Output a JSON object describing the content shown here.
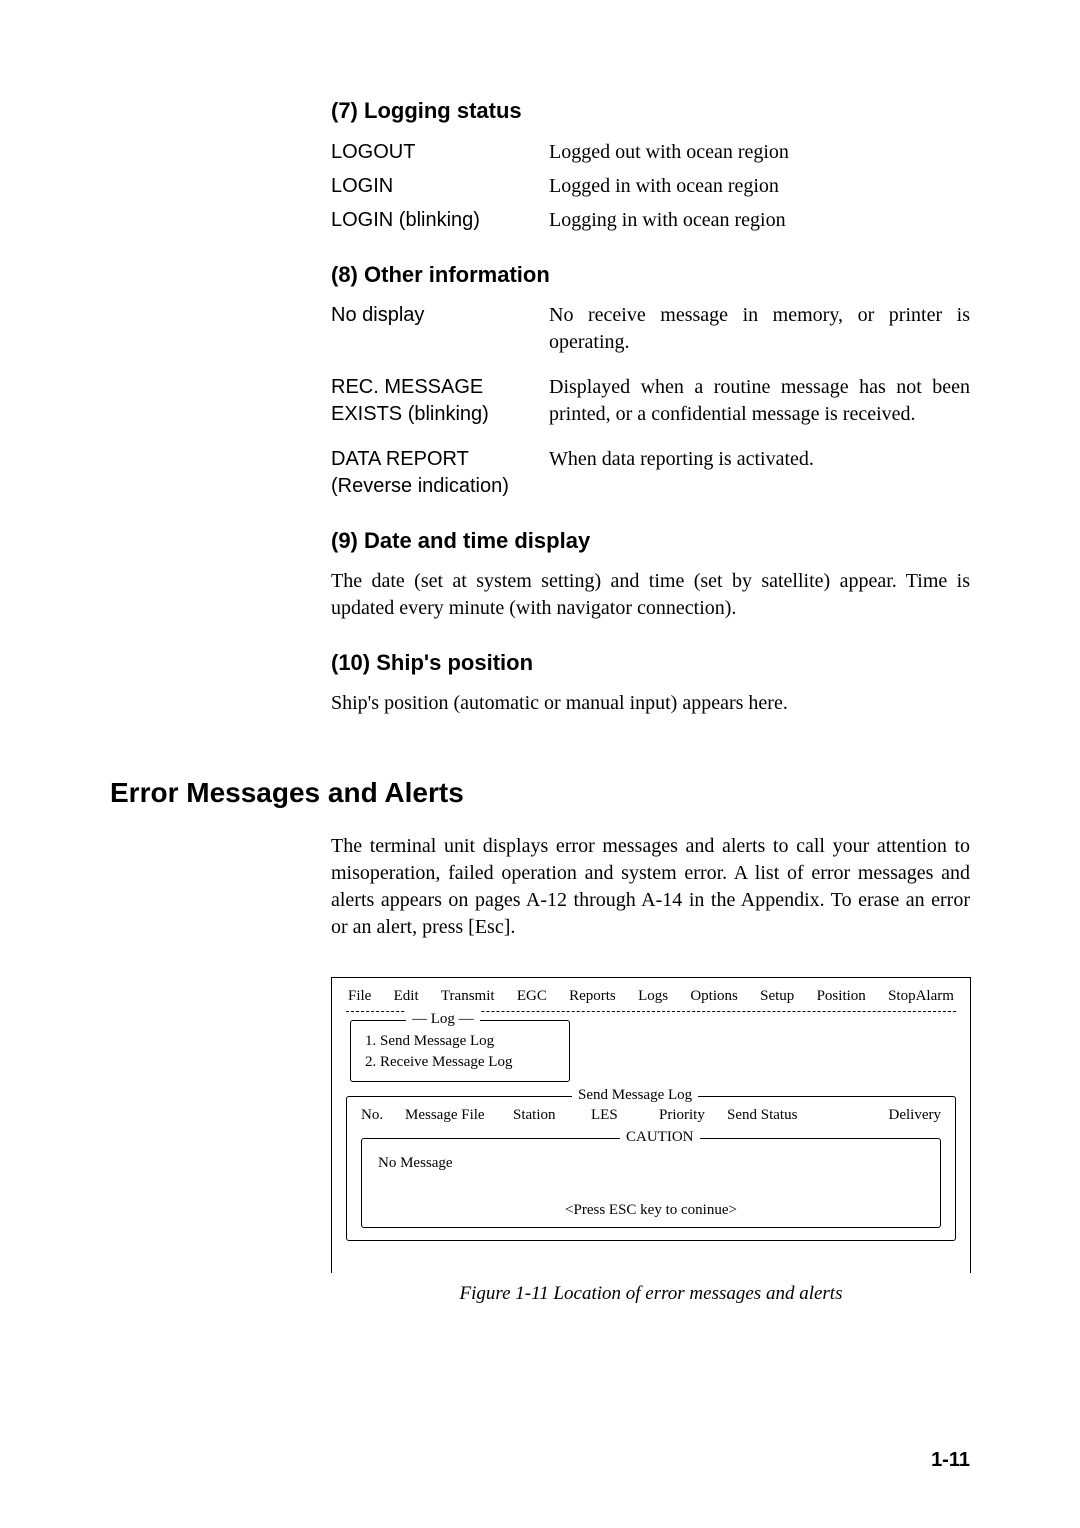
{
  "section7": {
    "heading": "(7) Logging status",
    "rows": [
      {
        "term": "LOGOUT",
        "desc": "Logged out with ocean region"
      },
      {
        "term": "LOGIN",
        "desc": "Logged in with ocean region"
      },
      {
        "term": "LOGIN (blinking)",
        "desc": "Logging in with ocean region"
      }
    ]
  },
  "section8": {
    "heading": "(8) Other information",
    "rows": [
      {
        "term": "No display",
        "desc": "No receive message in memory, or printer is operating."
      },
      {
        "term": "REC. MESSAGE EXISTS (blinking)",
        "desc": "Displayed when a routine message has not been printed, or a confidential message is received."
      },
      {
        "term": "DATA REPORT (Reverse indication)",
        "desc": "When data reporting is activated."
      }
    ]
  },
  "section9": {
    "heading": "(9) Date and time display",
    "body": "The date (set at system setting) and time (set by satellite) appear. Time is updated every minute (with navigator connection)."
  },
  "section10": {
    "heading": "(10) Ship's position",
    "body": "Ship's position (automatic or manual input) appears here."
  },
  "errors": {
    "heading": "Error Messages and Alerts",
    "body": "The terminal unit displays error messages and alerts to call your attention to misoperation, failed operation and system error. A list of error messages and alerts appears on pages A-12 through A-14 in the Appendix. To erase an error or an alert, press [Esc]."
  },
  "figure": {
    "menu": [
      "File",
      "Edit",
      "Transmit",
      "EGC",
      "Reports",
      "Logs",
      "Options",
      "Setup",
      "Position",
      "StopAlarm"
    ],
    "log_label": "Log",
    "log_items": [
      "1. Send Message Log",
      "2. Receive Message Log"
    ],
    "sml_label": "Send Message Log",
    "sml_headers": [
      "No.",
      "Message File",
      "Station",
      "LES",
      "Priority",
      "Send Status",
      "Delivery"
    ],
    "caution_label": "CAUTION",
    "no_message": "No Message",
    "esc_hint": "<Press ESC key to coninue>",
    "caption": "Figure 1-11 Location of error messages and alerts"
  },
  "page_number": "1-11"
}
